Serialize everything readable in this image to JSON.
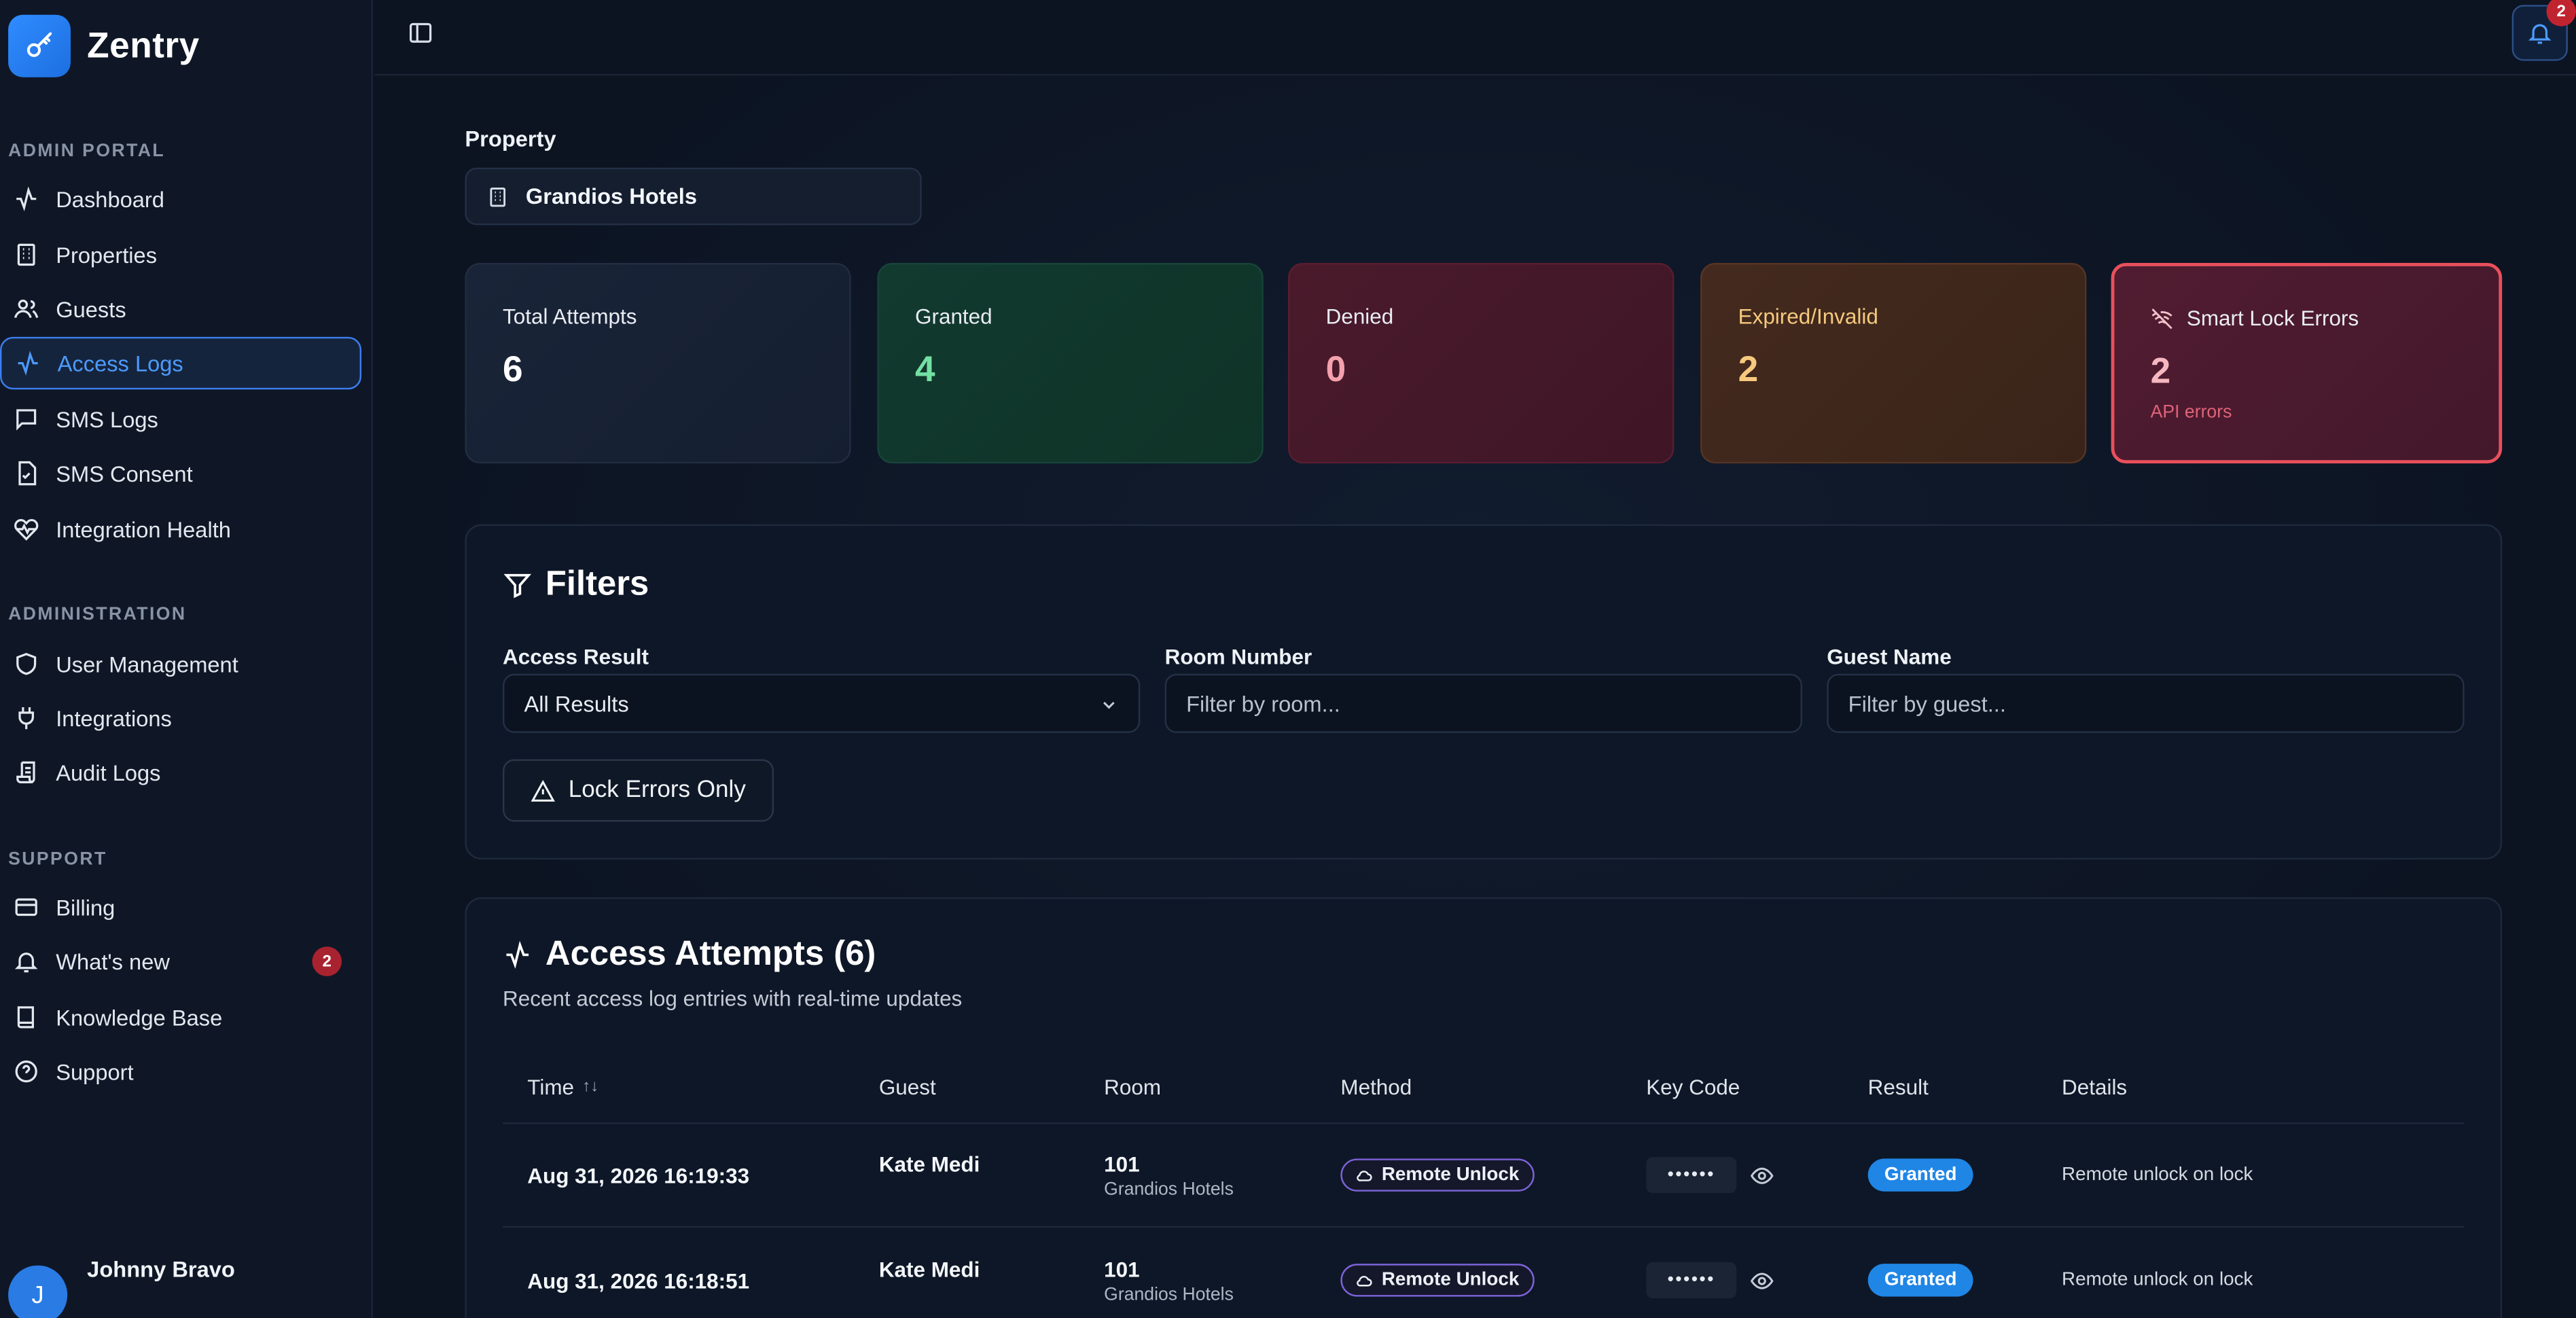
{
  "app": {
    "name": "Zentry"
  },
  "sidebar": {
    "sections": [
      {
        "label": "ADMIN PORTAL"
      },
      {
        "label": "ADMINISTRATION"
      },
      {
        "label": "SUPPORT"
      }
    ],
    "items": [
      {
        "label": "Dashboard",
        "icon": "activity-icon"
      },
      {
        "label": "Properties",
        "icon": "building-icon"
      },
      {
        "label": "Guests",
        "icon": "users-icon"
      },
      {
        "label": "Access Logs",
        "icon": "activity-icon",
        "active": true
      },
      {
        "label": "SMS Logs",
        "icon": "message-icon"
      },
      {
        "label": "SMS Consent",
        "icon": "file-check-icon"
      },
      {
        "label": "Integration Health",
        "icon": "heart-pulse-icon"
      },
      {
        "label": "User Management",
        "icon": "shield-icon"
      },
      {
        "label": "Integrations",
        "icon": "plug-icon"
      },
      {
        "label": "Audit Logs",
        "icon": "scroll-icon"
      },
      {
        "label": "Billing",
        "icon": "credit-card-icon"
      },
      {
        "label": "What's new",
        "icon": "bell-icon",
        "badge": "2"
      },
      {
        "label": "Knowledge Base",
        "icon": "book-icon"
      },
      {
        "label": "Support",
        "icon": "help-circle-icon"
      }
    ],
    "user": {
      "initial": "J",
      "name": "Johnny Bravo"
    }
  },
  "topbar": {
    "notifications_count": "2"
  },
  "property": {
    "label": "Property",
    "value": "Grandios Hotels"
  },
  "stats": {
    "total": {
      "label": "Total Attempts",
      "value": "6"
    },
    "granted": {
      "label": "Granted",
      "value": "4"
    },
    "denied": {
      "label": "Denied",
      "value": "0"
    },
    "expired": {
      "label": "Expired/Invalid",
      "value": "2"
    },
    "smart_lock": {
      "label": "Smart Lock Errors",
      "value": "2",
      "sub": "API errors"
    }
  },
  "filters": {
    "title": "Filters",
    "access_result": {
      "label": "Access Result",
      "value": "All Results"
    },
    "room_number": {
      "label": "Room Number",
      "placeholder": "Filter by room..."
    },
    "guest_name": {
      "label": "Guest Name",
      "placeholder": "Filter by guest..."
    },
    "lock_errors_button": "Lock Errors Only"
  },
  "attempts": {
    "title": "Access Attempts (6)",
    "subtitle": "Recent access log entries with real-time updates",
    "columns": [
      "Time",
      "Guest",
      "Room",
      "Method",
      "Key Code",
      "Result",
      "Details"
    ],
    "sort_icon": "↑↓",
    "rows": [
      {
        "time": "Aug 31, 2026 16:19:33",
        "guest": "Kate Medi",
        "room": "101",
        "property": "Grandios Hotels",
        "method": "Remote Unlock",
        "key_code": "••••••",
        "result": "Granted",
        "details": "Remote unlock on lock"
      },
      {
        "time": "Aug 31, 2026 16:18:51",
        "guest": "Kate Medi",
        "room": "101",
        "property": "Grandios Hotels",
        "method": "Remote Unlock",
        "key_code": "••••••",
        "result": "Granted",
        "details": "Remote unlock on lock"
      }
    ]
  },
  "colors": {
    "accent": "#3d7ef0",
    "granted": "#1f86e6",
    "danger": "#e8505c"
  }
}
